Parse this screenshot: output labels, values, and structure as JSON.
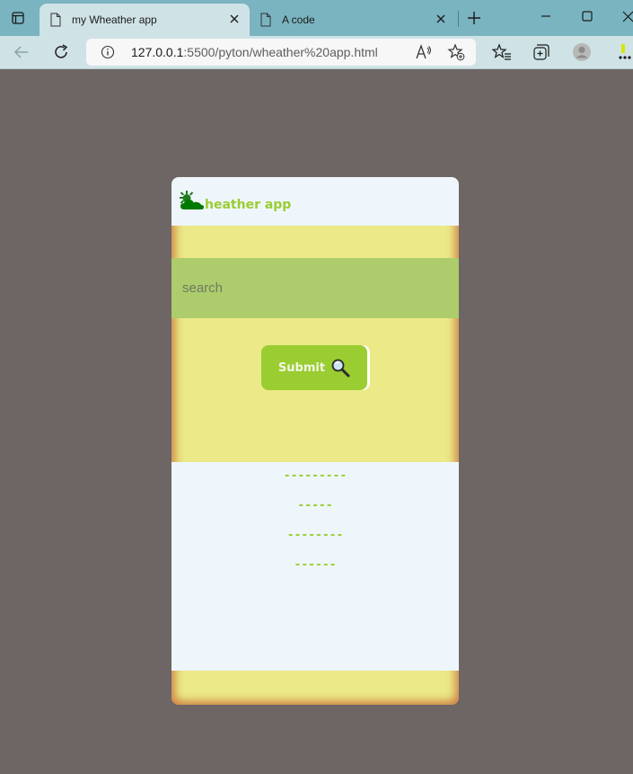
{
  "browser": {
    "tabs": [
      {
        "title": "my Wheather app",
        "active": true
      },
      {
        "title": "A code",
        "active": false
      }
    ],
    "url_host": "127.0.0.1",
    "url_rest": ":5500/pyton/wheather%20app.html"
  },
  "app": {
    "title": "heather app",
    "search": {
      "placeholder": "search",
      "value": ""
    },
    "submit_label": "Submit",
    "results": [
      "---------",
      "-----",
      "--------",
      "------"
    ]
  },
  "colors": {
    "page_bg": "#6e6565",
    "accent": "#9acd32",
    "card_bg": "#ebe988",
    "search_bg": "#adcc6b",
    "panel_bg": "#eef6fb"
  }
}
